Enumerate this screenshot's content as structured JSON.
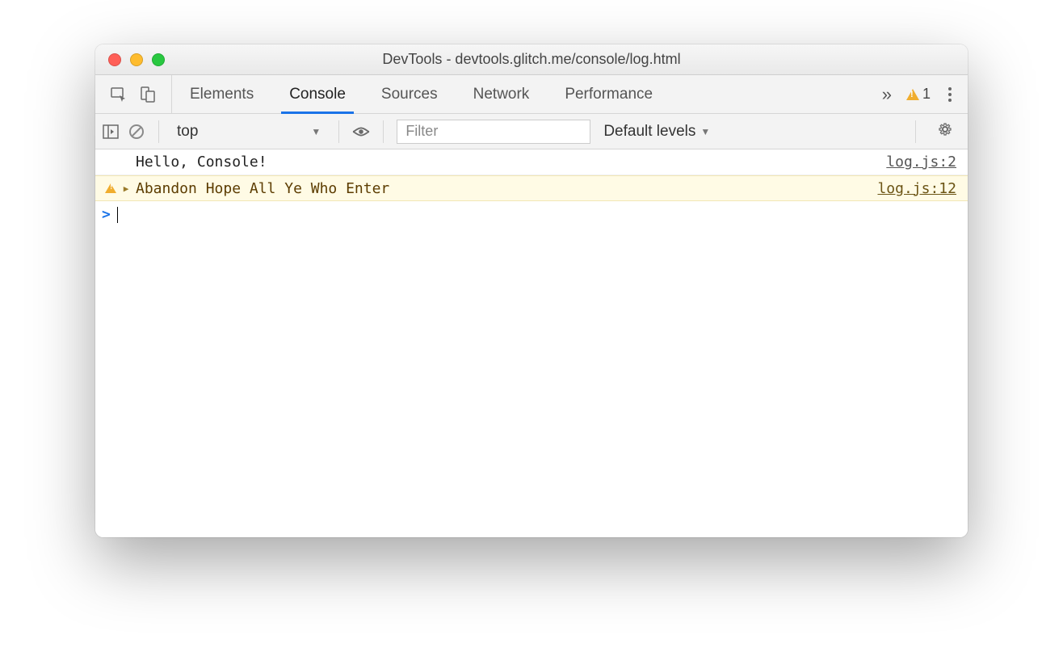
{
  "window": {
    "title": "DevTools - devtools.glitch.me/console/log.html"
  },
  "tabs": {
    "items": [
      "Elements",
      "Console",
      "Sources",
      "Network",
      "Performance"
    ],
    "active": "Console",
    "overflow_glyph": "»",
    "warning_count": "1"
  },
  "toolbar": {
    "context": "top",
    "filter_placeholder": "Filter",
    "levels_label": "Default levels"
  },
  "console": {
    "rows": [
      {
        "type": "log",
        "message": "Hello, Console!",
        "source": "log.js:2"
      },
      {
        "type": "warn",
        "message": "Abandon Hope All Ye Who Enter",
        "source": "log.js:12"
      }
    ],
    "prompt": ">"
  }
}
